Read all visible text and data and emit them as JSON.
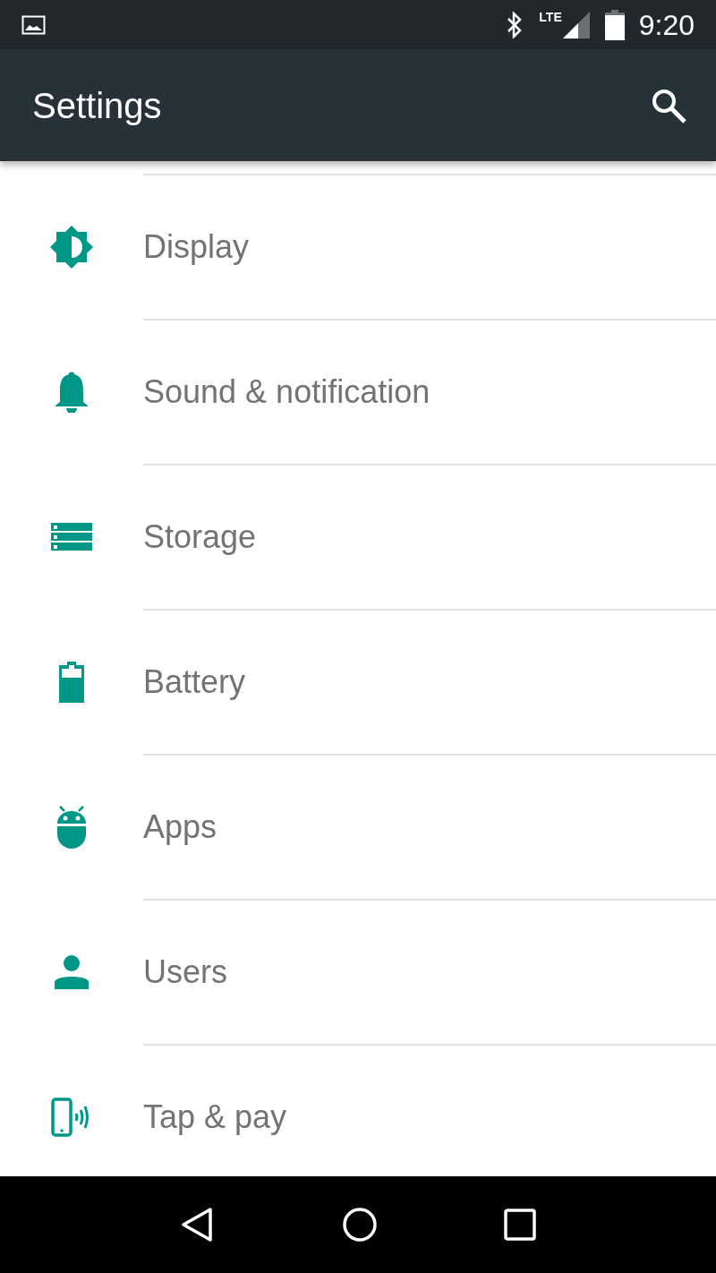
{
  "status_bar": {
    "time": "9:20",
    "network": "LTE"
  },
  "app_bar": {
    "title": "Settings"
  },
  "items": [
    {
      "label": "Display"
    },
    {
      "label": "Sound & notification"
    },
    {
      "label": "Storage"
    },
    {
      "label": "Battery"
    },
    {
      "label": "Apps"
    },
    {
      "label": "Users"
    },
    {
      "label": "Tap & pay"
    }
  ]
}
